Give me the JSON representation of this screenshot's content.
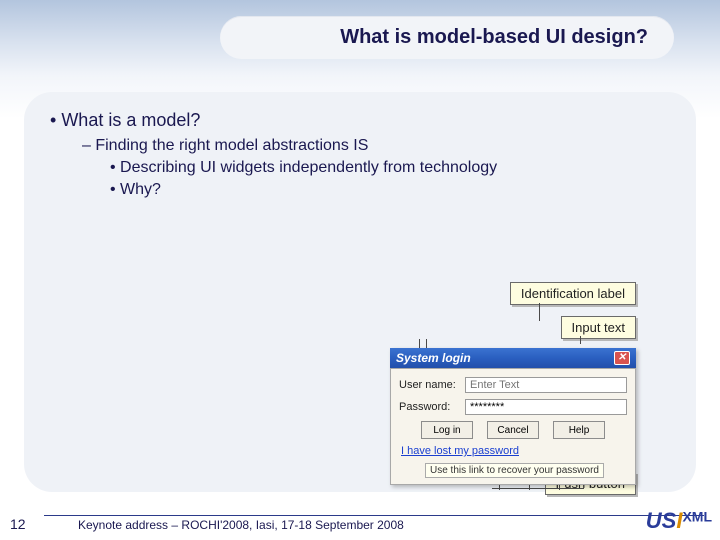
{
  "title": "What is model-based UI design?",
  "bullets": {
    "l1": "What is a model?",
    "l2": "Finding the right model abstractions IS",
    "l3a": "Describing UI widgets independently from technology",
    "l3b": "Why?"
  },
  "annotations": {
    "identification_label": "Identification label",
    "input_text": "Input text",
    "push_button": "Push button"
  },
  "dialog": {
    "title": "System login",
    "username_label": "User name:",
    "username_placeholder": "Enter Text",
    "password_label": "Password:",
    "password_value": "********",
    "login_btn": "Log in",
    "cancel_btn": "Cancel",
    "help_btn": "Help",
    "link": "I have lost my password",
    "tooltip": "Use this link to recover your password"
  },
  "footer": {
    "slide_number": "12",
    "text": "Keynote address – ROCHI'2008, Iasi, 17-18 September 2008"
  },
  "logo": {
    "u": "US",
    "s": "I",
    "x": "XML"
  }
}
